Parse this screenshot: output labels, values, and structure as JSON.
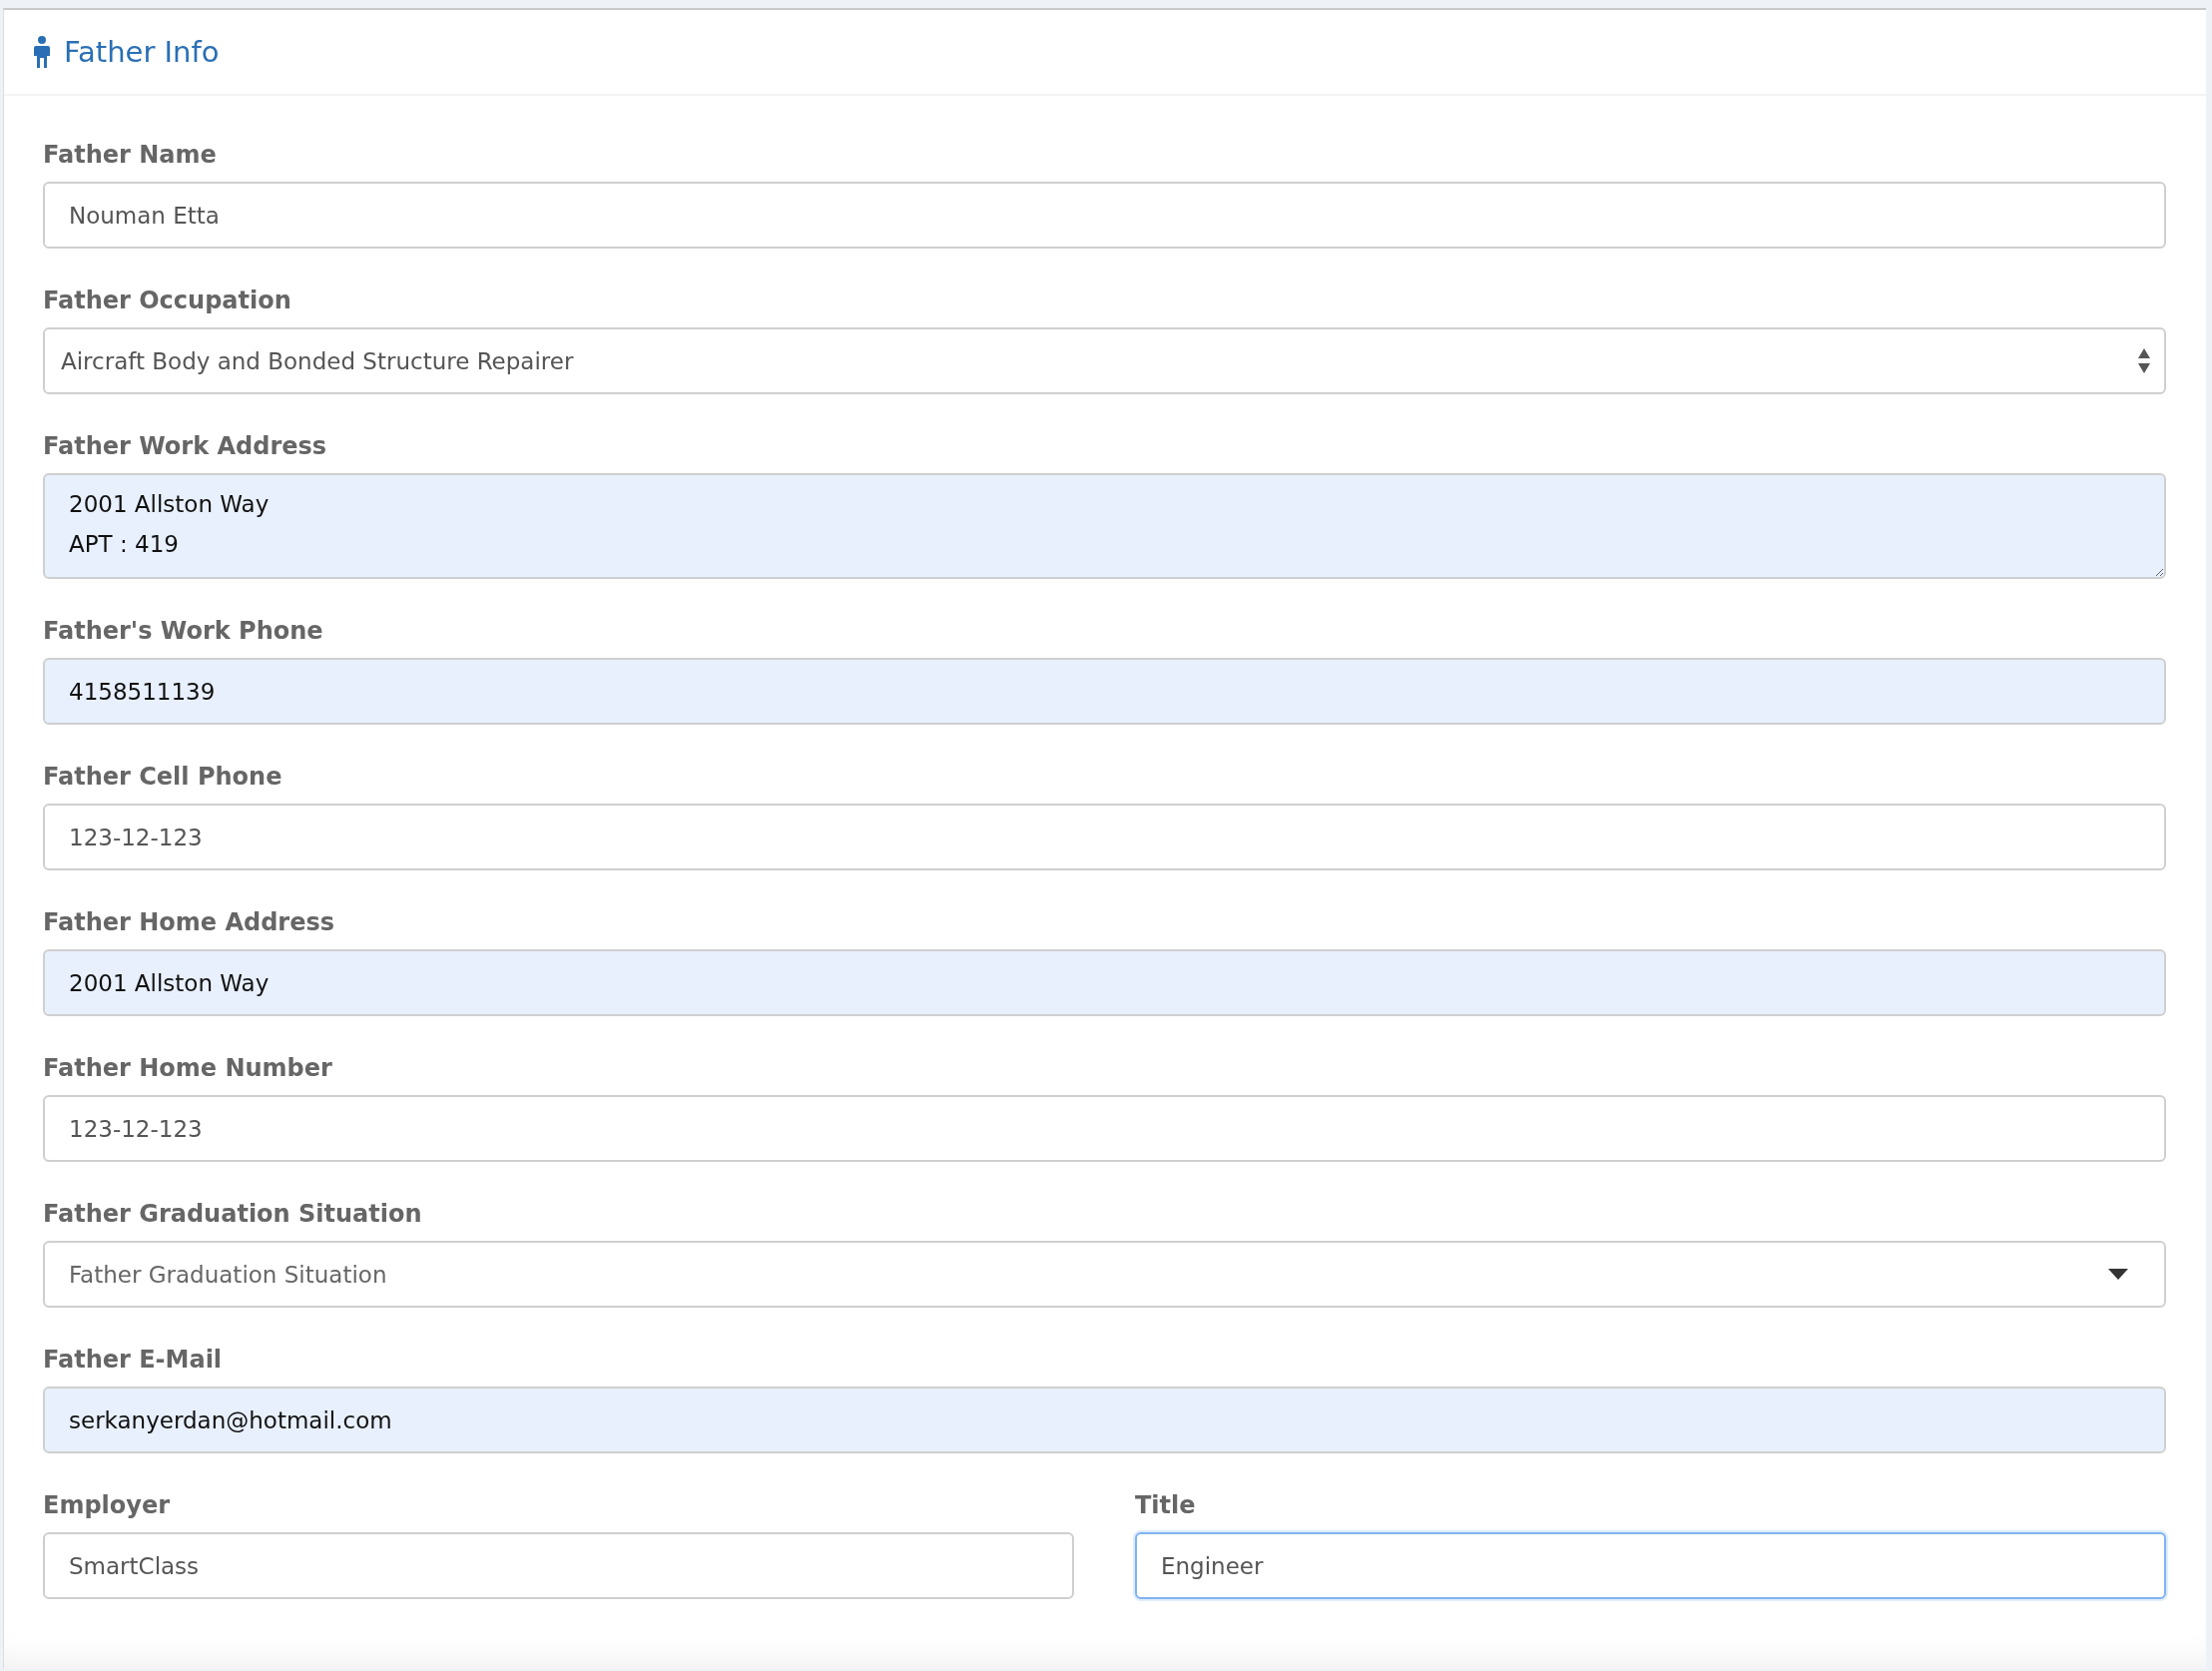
{
  "panel": {
    "title": "Father Info"
  },
  "fields": [
    {
      "kind": "text",
      "label": "Father Name",
      "value": "Nouman Etta",
      "autofilled": false
    },
    {
      "kind": "select",
      "label": "Father Occupation",
      "value": "Aircraft Body and Bonded Structure Repairer",
      "autofilled": false
    },
    {
      "kind": "textarea",
      "label": "Father Work Address",
      "value": "2001 Allston Way\nAPT : 419",
      "autofilled": true
    },
    {
      "kind": "text",
      "label": "Father's Work Phone",
      "value": "4158511139",
      "autofilled": true
    },
    {
      "kind": "text",
      "label": "Father Cell Phone",
      "value": "123-12-123",
      "autofilled": false
    },
    {
      "kind": "text",
      "label": "Father Home Address",
      "value": "2001 Allston Way",
      "autofilled": true
    },
    {
      "kind": "text",
      "label": "Father Home Number",
      "value": "123-12-123",
      "autofilled": false
    },
    {
      "kind": "dropdown",
      "label": "Father Graduation Situation",
      "placeholder": "Father Graduation Situation",
      "autofilled": false
    },
    {
      "kind": "text",
      "label": "Father E-Mail",
      "value": "serkanyerdan@hotmail.com",
      "autofilled": true
    }
  ],
  "bottom_fields": [
    {
      "label": "Employer",
      "value": "SmartClass",
      "focused": false
    },
    {
      "label": "Title",
      "value": "Engineer",
      "focused": true
    }
  ]
}
